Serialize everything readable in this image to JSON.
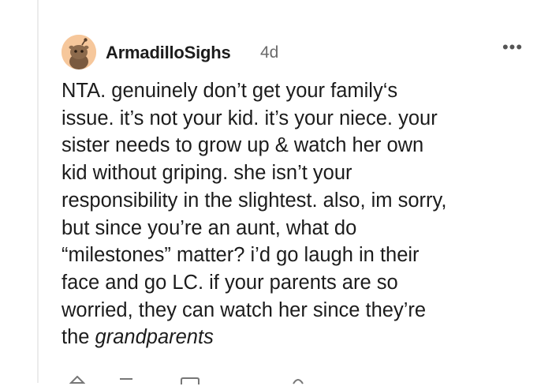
{
  "comment": {
    "author": "ArmadilloSighs",
    "age": "4d",
    "more_label": "•••",
    "avatar_icon": "snoo-avatar-icon",
    "body_lines": [
      "NTA. genuinely don’t get your family‘s",
      "issue. it’s not your kid. it’s your niece. your",
      "sister needs to grow up & watch her own",
      "kid without griping. she isn’t your",
      "responsibility in the slightest. also, im sorry,",
      "but since you’re an aunt, what do",
      "“milestones” matter? i’d go laugh in their",
      "face and go LC. if your parents are so",
      "worried, they can watch her since they’re",
      "the "
    ],
    "body_emphasis": "grandparents"
  },
  "colors": {
    "text": "#1c1c1c",
    "meta": "#6b6b6b",
    "avatar_bg": "#f6c79b",
    "thread_line": "#ececec"
  },
  "icons": {
    "upvote": "upvote-icon",
    "reply": "reply-icon",
    "award": "award-icon",
    "share": "share-icon"
  }
}
